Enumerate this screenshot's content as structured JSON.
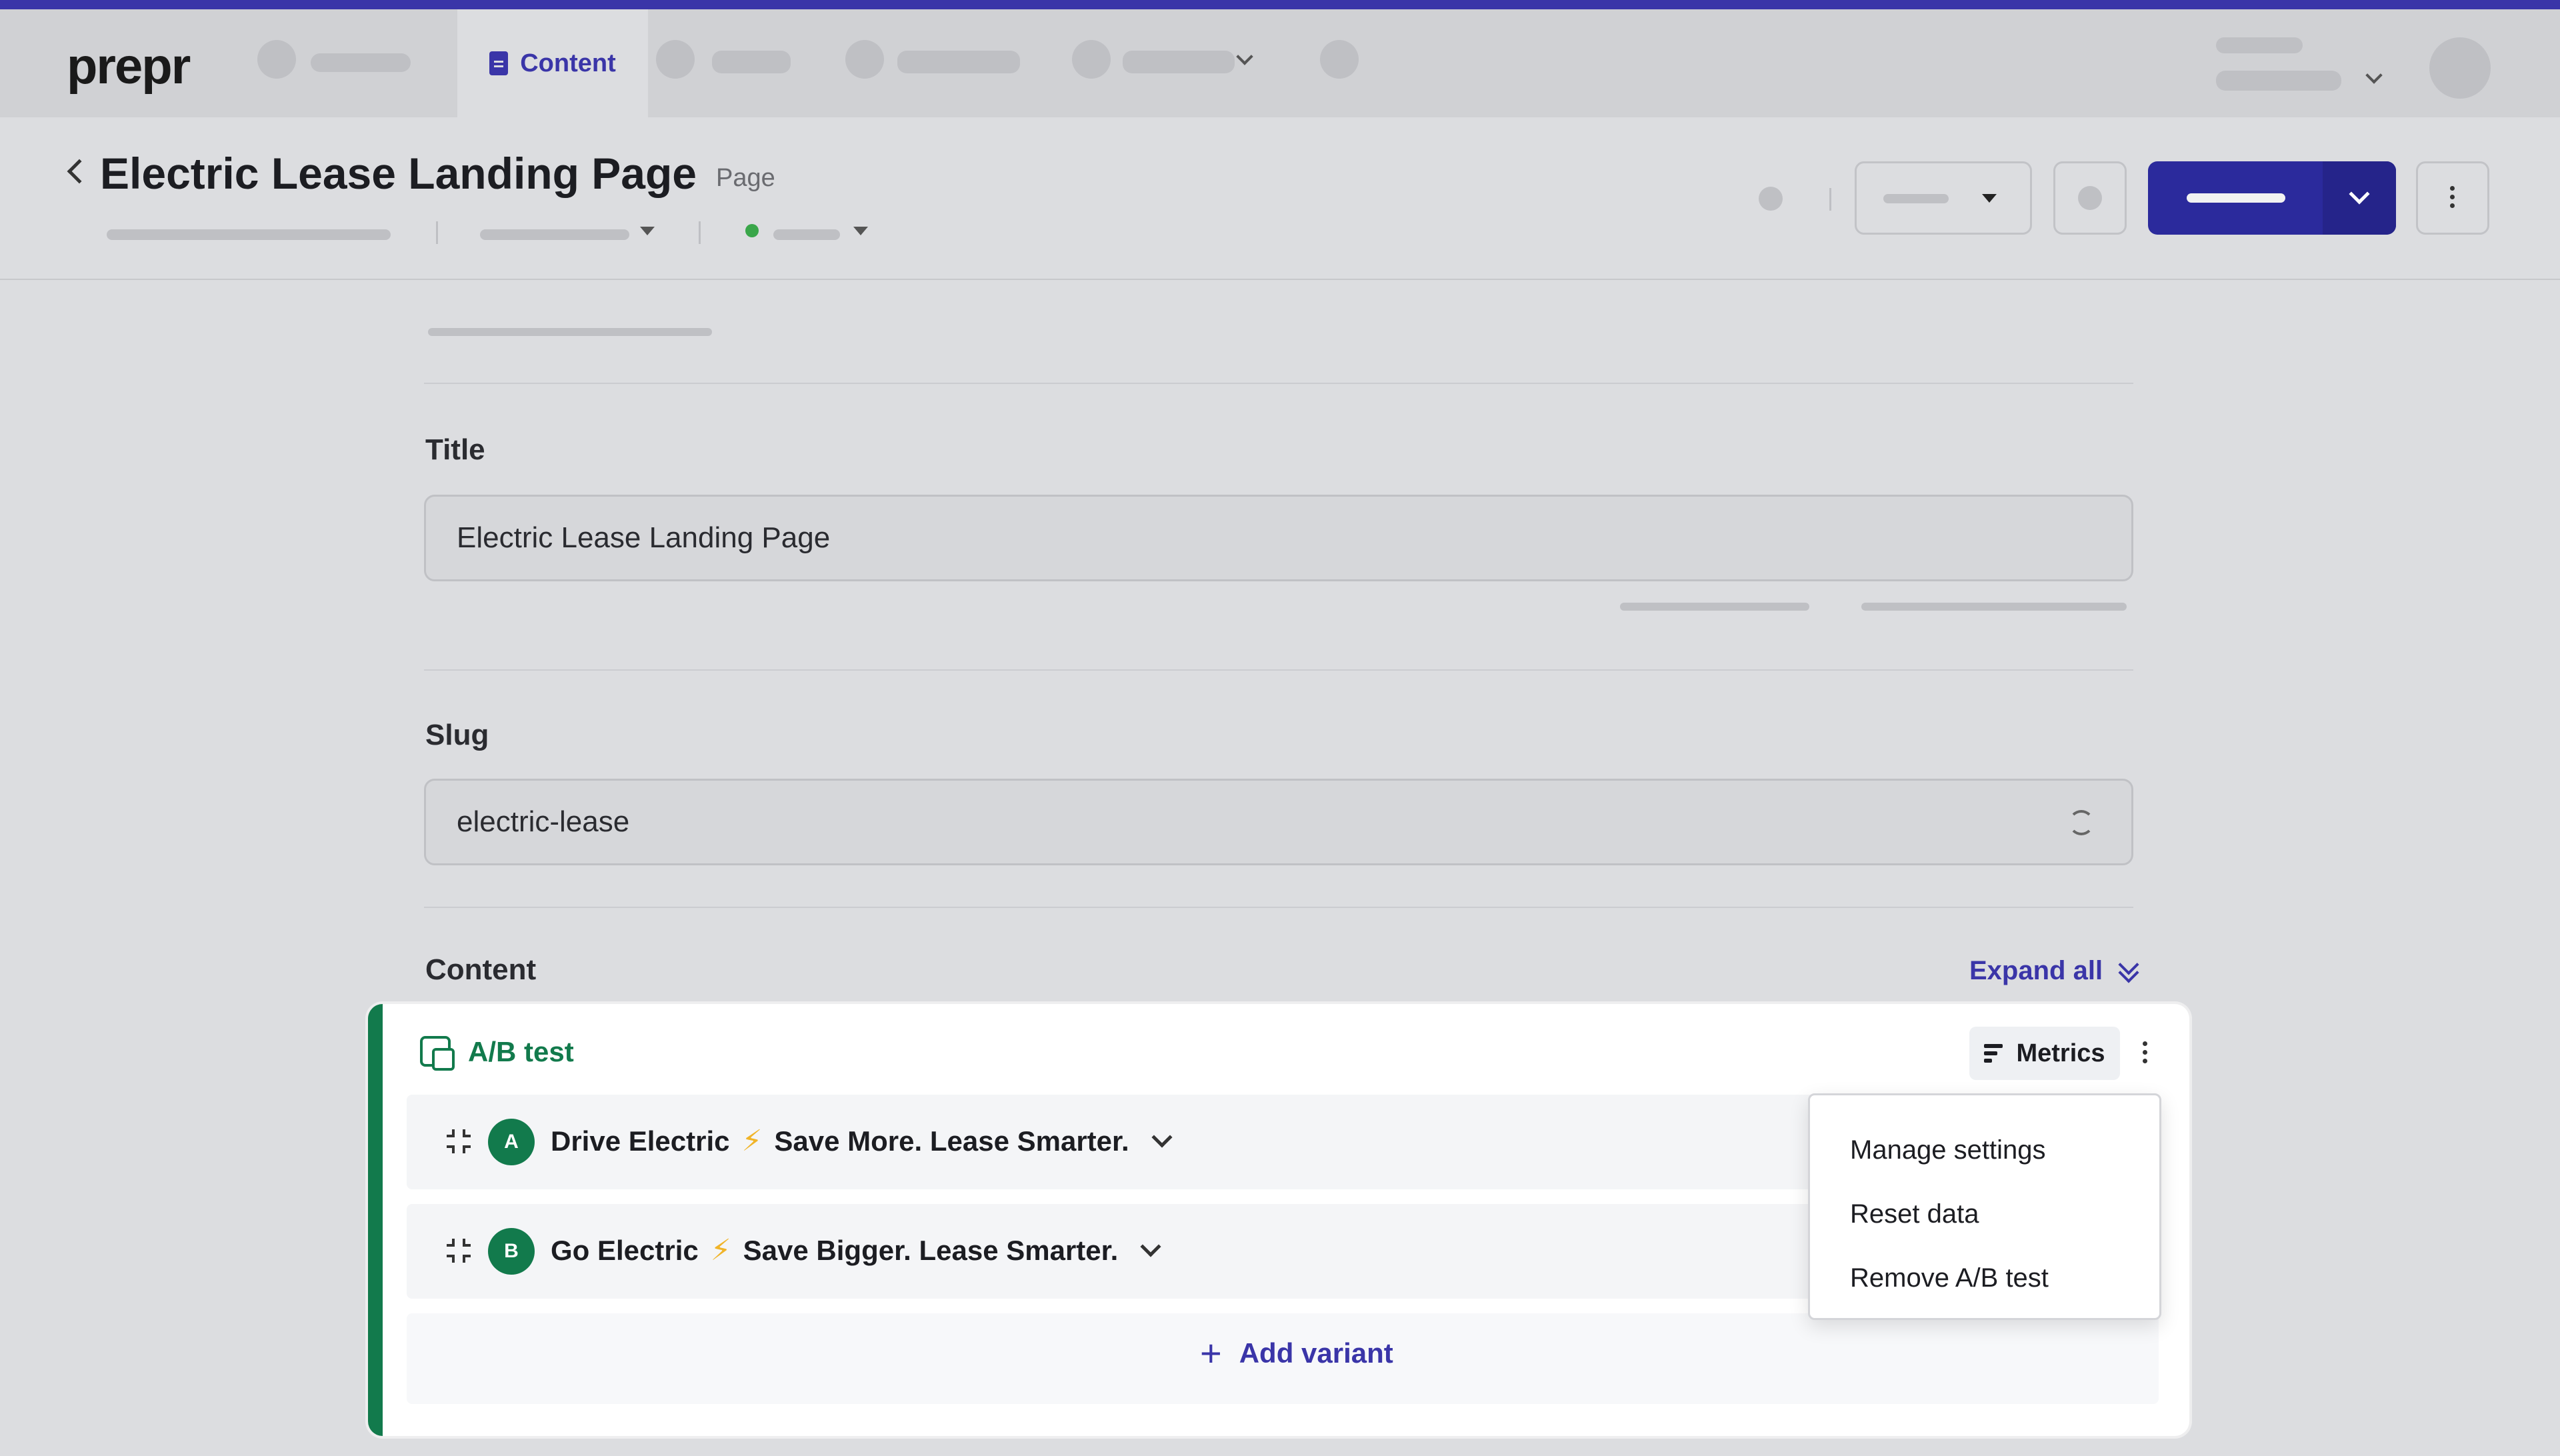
{
  "app": {
    "logo": "prepr"
  },
  "nav": {
    "active_label": "Content"
  },
  "header": {
    "title": "Electric Lease Landing Page",
    "type": "Page"
  },
  "fields": {
    "title": {
      "label": "Title",
      "value": "Electric Lease Landing Page"
    },
    "slug": {
      "label": "Slug",
      "value": "electric-lease"
    },
    "content": {
      "label": "Content",
      "expand_all": "Expand all"
    }
  },
  "ab_test": {
    "title": "A/B test",
    "metrics_label": "Metrics",
    "variants": [
      {
        "badge": "A",
        "name": "Drive Electric",
        "bolt": "⚡",
        "subtitle": "Save More. Lease Smarter."
      },
      {
        "badge": "B",
        "name": "Go Electric",
        "bolt": "⚡",
        "subtitle": "Save Bigger. Lease Smarter."
      }
    ],
    "add_variant": "Add variant",
    "add_icon": "+"
  },
  "dropdown": {
    "items": [
      "Manage settings",
      "Reset data",
      "Remove A/B test"
    ]
  },
  "colors": {
    "accent": "#3a35a8",
    "primary_button": "#2b2a9c",
    "ab_green": "#127a4c",
    "status_green": "#3aa64a"
  }
}
